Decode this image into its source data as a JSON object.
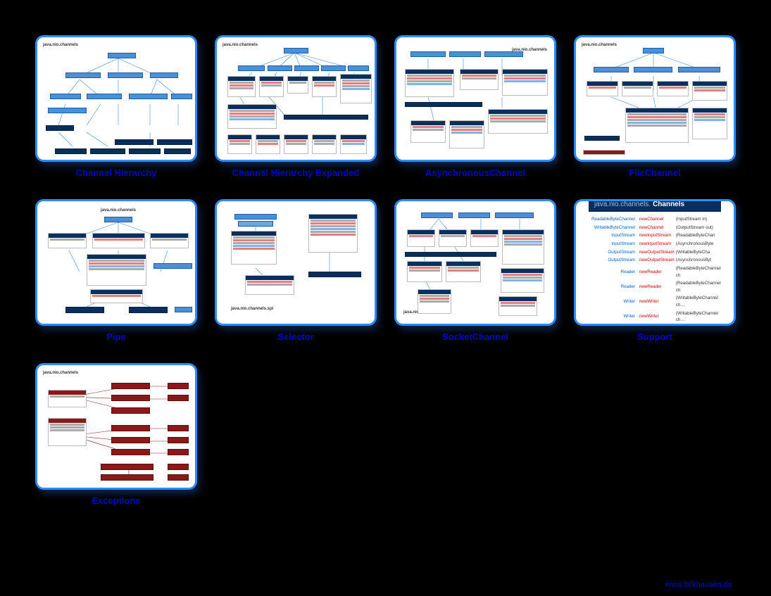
{
  "cards": [
    {
      "title": "Channel Hierarchy",
      "package": "java.nio.channels"
    },
    {
      "title": "Channel Hierarchy Expanded",
      "package": "java.nio.channels"
    },
    {
      "title": "AsynchronousChannel",
      "package": "java.nio.channels"
    },
    {
      "title": "FileChannel",
      "package": "java.nio.channels"
    },
    {
      "title": "Pipe",
      "package": "java.nio.channels"
    },
    {
      "title": "Selector",
      "package": "java.nio.channels.spi"
    },
    {
      "title": "SocketChannel",
      "package": "java.nio.channels"
    },
    {
      "title": "Support",
      "package": "java.nio.channels"
    },
    {
      "title": "Exceptions",
      "package": "java.nio.channels"
    }
  ],
  "support": {
    "headerPackage": "java.nio.channels.",
    "headerClass": "Channels",
    "rows": [
      {
        "ret": "ReadableByteChannel",
        "m": "newChannel",
        "arg": "(InputStream in)"
      },
      {
        "ret": "WritableByteChannel",
        "m": "newChannel",
        "arg": "(OutputStream out)"
      },
      {
        "ret": "InputStream",
        "m": "newInputStream",
        "arg": "(ReadableByteChan"
      },
      {
        "ret": "InputStream",
        "m": "newInputStream",
        "arg": "(AsynchronousByte"
      },
      {
        "ret": "OutputStream",
        "m": "newOutputStream",
        "arg": "(WritableByteCha"
      },
      {
        "ret": "OutputStream",
        "m": "newOutputStream",
        "arg": "(AsynchronousByt"
      },
      {
        "ret": "Reader",
        "m": "newReader",
        "arg": "(ReadableByteChannel ch"
      },
      {
        "ret": "Reader",
        "m": "newReader",
        "arg": "(ReadableByteChannel ch"
      },
      {
        "ret": "Writer",
        "m": "newWriter",
        "arg": "(WritableByteChannel ch…"
      },
      {
        "ret": "Writer",
        "m": "newWriter",
        "arg": "(WritableByteChannel ch…"
      }
    ]
  },
  "footer": "www.falkhausen.de"
}
